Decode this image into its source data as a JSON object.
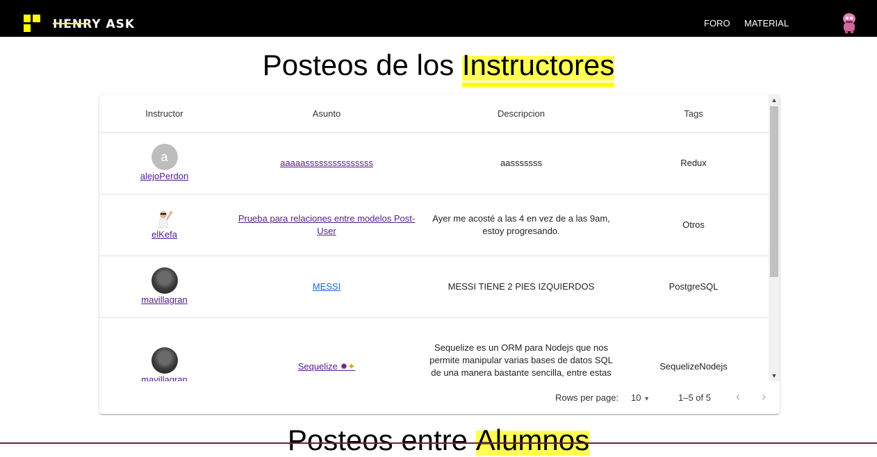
{
  "nav": {
    "brand": "HENRY ASK",
    "links": [
      "FORO",
      "MATERIAL"
    ]
  },
  "page": {
    "title_prefix": "Posteos de los ",
    "title_highlight": "Instructores",
    "next_title_prefix": "Posteos entre ",
    "next_title_highlight": "Alumnos"
  },
  "table": {
    "headers": [
      "Instructor",
      "Asunto",
      "Descripcion",
      "Tags"
    ],
    "rows": [
      {
        "avatar_letter": "a",
        "instructor": "alejoPerdon",
        "asunto": "aaaaasssssssssssssss",
        "descripcion": "aasssssss",
        "tags": "Redux"
      },
      {
        "instructor": "elKefa",
        "asunto": "Prueba para relaciones entre modelos Post-User",
        "descripcion": "Ayer me acosté a las 4 en vez de a las 9am, estoy progresando.",
        "tags": "Otros"
      },
      {
        "instructor": "mavillagran",
        "asunto": "MESSI",
        "descripcion": "MESSI TIENE 2 PIES IZQUIERDOS",
        "tags": "PostgreSQL"
      },
      {
        "instructor": "mavillagran",
        "asunto": "Sequelize",
        "descripcion": "Sequelize es un ORM para Nodejs que nos permite manipular varias bases de datos SQL de una manera bastante sencilla, entre estas bases de datos",
        "tags": "SequelizeNodejs"
      }
    ]
  },
  "pagination": {
    "rows_label": "Rows per page:",
    "rows_value": "10",
    "range": "1–5 of 5"
  },
  "colors": {
    "accent": "#ffff01",
    "navbar": "#000000"
  }
}
